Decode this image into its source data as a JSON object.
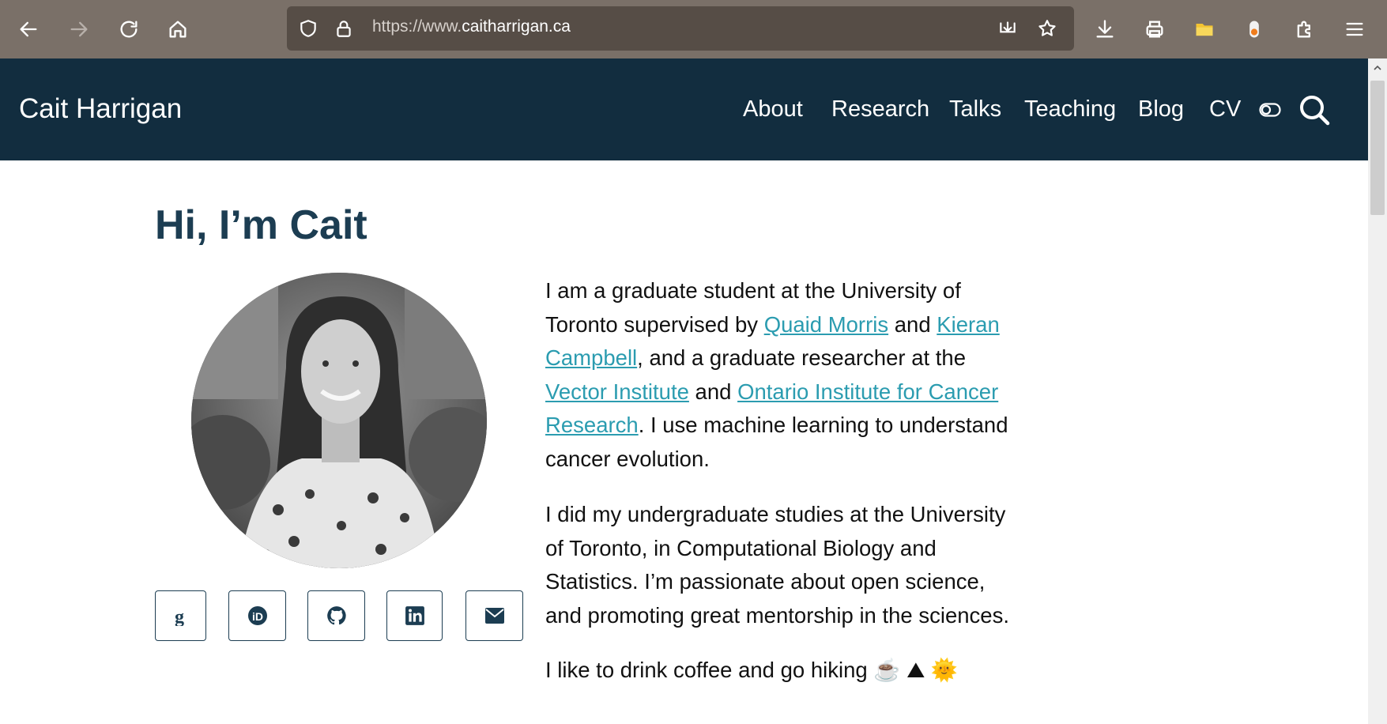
{
  "browser": {
    "url_prefix": "https://www.",
    "url_domain": "caitharrigan.ca",
    "icons": [
      "back-icon",
      "forward-icon",
      "reload-icon",
      "home-icon",
      "shield-icon",
      "lock-icon",
      "pocket-icon",
      "bookmark-star-icon",
      "download-icon",
      "printer-icon",
      "folder-icon",
      "extension-dot-icon",
      "puzzle-icon",
      "menu-icon"
    ]
  },
  "header": {
    "site_title": "Cait Harrigan",
    "nav": [
      "About",
      "Research",
      "Talks",
      "Teaching",
      "Blog",
      "CV"
    ],
    "bg_color": "#122d3f"
  },
  "main": {
    "heading": "Hi, I’m Cait",
    "social_icons": [
      "google-scholar-icon",
      "orcid-icon",
      "github-icon",
      "linkedin-icon",
      "email-icon"
    ],
    "bio": {
      "p1_t1": "I am a graduate student at the University of Toronto supervised by ",
      "p1_l1": "Quaid Morris",
      "p1_t2": " and ",
      "p1_l2": "Kieran Campbell",
      "p1_t3": ", and a graduate researcher at the ",
      "p1_l3": "Vector Institute",
      "p1_t4": " and ",
      "p1_l4": "Ontario Institute for Cancer Research",
      "p1_t5": ". I use machine learning to understand cancer evolution.",
      "p2": "I did my undergraduate studies at the University of Toronto, in Computational Biology and Statistics. I’m passionate about open science, and promoting great mentorship in the sciences.",
      "p3": "I like to drink coffee and go hiking ☕ ⛰ 🌞"
    },
    "heading_color": "#1c3d52",
    "link_color": "#2b9cb0"
  }
}
